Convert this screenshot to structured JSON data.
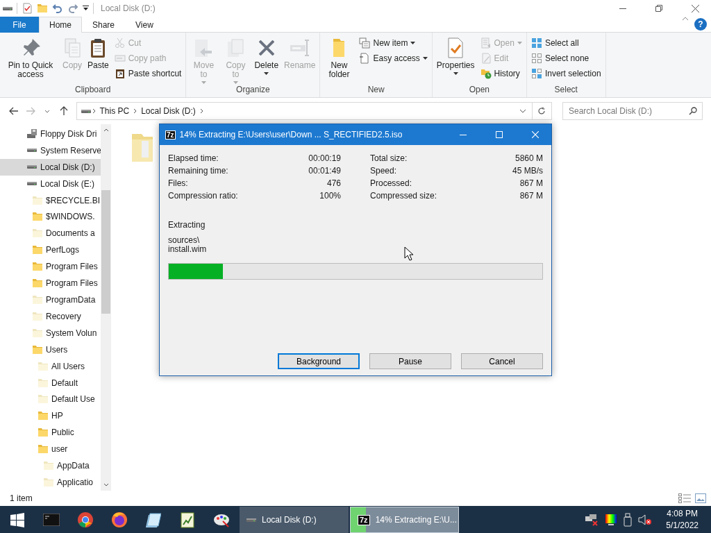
{
  "window": {
    "title": "Local Disk (D:)"
  },
  "ribbon_tabs": [
    {
      "label": "File",
      "kind": "file",
      "selected": false
    },
    {
      "label": "Home",
      "kind": "tab",
      "selected": true
    },
    {
      "label": "Share",
      "kind": "tab",
      "selected": false
    },
    {
      "label": "View",
      "kind": "tab",
      "selected": false
    }
  ],
  "ribbon_help": {
    "label": "?"
  },
  "ribbon_groups": [
    {
      "name": "Clipboard",
      "items": [
        {
          "label": "Pin to Quick access",
          "kind": "large",
          "disabled": false,
          "dropdown": false
        },
        {
          "label": "Copy",
          "kind": "large",
          "disabled": true,
          "dropdown": false
        },
        {
          "label": "Paste",
          "kind": "large",
          "disabled": false,
          "dropdown": false
        },
        {
          "label": "Cut",
          "kind": "small",
          "disabled": true,
          "dropdown": false
        },
        {
          "label": "Copy path",
          "kind": "small",
          "disabled": true,
          "dropdown": false
        },
        {
          "label": "Paste shortcut",
          "kind": "small",
          "disabled": false,
          "dropdown": false
        }
      ]
    },
    {
      "name": "Organize",
      "items": [
        {
          "label": "Move to",
          "kind": "large",
          "disabled": true,
          "dropdown": true
        },
        {
          "label": "Copy to",
          "kind": "large",
          "disabled": true,
          "dropdown": true
        },
        {
          "label": "Delete",
          "kind": "large",
          "disabled": false,
          "dropdown": true
        },
        {
          "label": "Rename",
          "kind": "large",
          "disabled": true,
          "dropdown": false
        }
      ]
    },
    {
      "name": "New",
      "items": [
        {
          "label": "New folder",
          "kind": "large",
          "disabled": false,
          "dropdown": false
        },
        {
          "label": "New item",
          "kind": "small",
          "disabled": false,
          "dropdown": true
        },
        {
          "label": "Easy access",
          "kind": "small",
          "disabled": false,
          "dropdown": true
        }
      ]
    },
    {
      "name": "Open",
      "items": [
        {
          "label": "Properties",
          "kind": "large",
          "disabled": false,
          "dropdown": true
        },
        {
          "label": "Open",
          "kind": "small",
          "disabled": true,
          "dropdown": true
        },
        {
          "label": "Edit",
          "kind": "small",
          "disabled": true,
          "dropdown": false
        },
        {
          "label": "History",
          "kind": "small",
          "disabled": false,
          "dropdown": false
        }
      ]
    },
    {
      "name": "Select",
      "items": [
        {
          "label": "Select all",
          "kind": "small",
          "disabled": false,
          "dropdown": false
        },
        {
          "label": "Select none",
          "kind": "small",
          "disabled": false,
          "dropdown": false
        },
        {
          "label": "Invert selection",
          "kind": "small",
          "disabled": false,
          "dropdown": false
        }
      ]
    }
  ],
  "address_bar": {
    "path": [
      "This PC",
      "Local Disk (D:)"
    ]
  },
  "search": {
    "placeholder": "Search Local Disk (D:)"
  },
  "nav_tree": [
    {
      "label": "Floppy Disk Dri",
      "kind": "floppy",
      "selected": false
    },
    {
      "label": "System Reserve",
      "kind": "drive",
      "selected": false
    },
    {
      "label": "Local Disk (D:)",
      "kind": "drive",
      "selected": true
    },
    {
      "label": "Local Disk (E:)",
      "kind": "drive",
      "selected": false,
      "children": [
        {
          "label": "$RECYCLE.BI",
          "kind": "folder",
          "selected": false,
          "dimmed": true
        },
        {
          "label": "$WINDOWS.",
          "kind": "folder",
          "selected": false,
          "dimmed": false
        },
        {
          "label": "Documents a",
          "kind": "folder",
          "selected": false,
          "dimmed": true
        },
        {
          "label": "PerfLogs",
          "kind": "folder",
          "selected": false,
          "dimmed": false
        },
        {
          "label": "Program Files",
          "kind": "folder",
          "selected": false,
          "dimmed": false
        },
        {
          "label": "Program Files",
          "kind": "folder",
          "selected": false,
          "dimmed": false
        },
        {
          "label": "ProgramData",
          "kind": "folder",
          "selected": false,
          "dimmed": true
        },
        {
          "label": "Recovery",
          "kind": "folder",
          "selected": false,
          "dimmed": true
        },
        {
          "label": "System Volun",
          "kind": "folder",
          "selected": false,
          "dimmed": true
        },
        {
          "label": "Users",
          "kind": "folder",
          "selected": false,
          "dimmed": false,
          "children": [
            {
              "label": "All Users",
              "kind": "folder",
              "selected": false,
              "dimmed": true
            },
            {
              "label": "Default",
              "kind": "folder",
              "selected": false,
              "dimmed": true
            },
            {
              "label": "Default Use",
              "kind": "folder",
              "selected": false,
              "dimmed": true
            },
            {
              "label": "HP",
              "kind": "folder",
              "selected": false,
              "dimmed": false
            },
            {
              "label": "Public",
              "kind": "folder",
              "selected": false,
              "dimmed": false
            },
            {
              "label": "user",
              "kind": "folder",
              "selected": false,
              "dimmed": false,
              "children": [
                {
                  "label": "AppData",
                  "kind": "folder",
                  "selected": false,
                  "dimmed": true
                },
                {
                  "label": "Applicatio",
                  "kind": "folder",
                  "selected": false,
                  "dimmed": true
                }
              ]
            }
          ]
        }
      ]
    }
  ],
  "status_bar": {
    "text": "1 item"
  },
  "dialog": {
    "badge": "7z",
    "title": "14% Extracting E:\\Users\\user\\Down ... S_RECTIFIED2.5.iso",
    "stats_left": [
      {
        "label": "Elapsed time:",
        "value": "00:00:19"
      },
      {
        "label": "Remaining time:",
        "value": "00:01:49"
      },
      {
        "label": "Files:",
        "value": "476"
      },
      {
        "label": "Compression ratio:",
        "value": "100%"
      }
    ],
    "stats_right": [
      {
        "label": "Total size:",
        "value": "5860 M"
      },
      {
        "label": "Speed:",
        "value": "45 MB/s"
      },
      {
        "label": "Processed:",
        "value": "867 M"
      },
      {
        "label": "Compressed size:",
        "value": "867 M"
      }
    ],
    "status_label": "Extracting",
    "current_file": [
      "sources\\",
      "install.wim"
    ],
    "progress": {
      "level": 0.145
    },
    "buttons": [
      {
        "label": "Background",
        "focused": true
      },
      {
        "label": "Pause",
        "focused": false
      },
      {
        "label": "Cancel",
        "focused": false
      }
    ]
  },
  "taskbar": {
    "windows": [
      {
        "label": "Local Disk (D:)",
        "kind": "explorer",
        "selected": false
      },
      {
        "label": "14% Extracting E:\\U...",
        "kind": "archiver",
        "badge": "7z",
        "selected": true,
        "level": 0.14
      }
    ],
    "clock": {
      "time": "4:08 PM",
      "date": "5/1/2022"
    }
  }
}
